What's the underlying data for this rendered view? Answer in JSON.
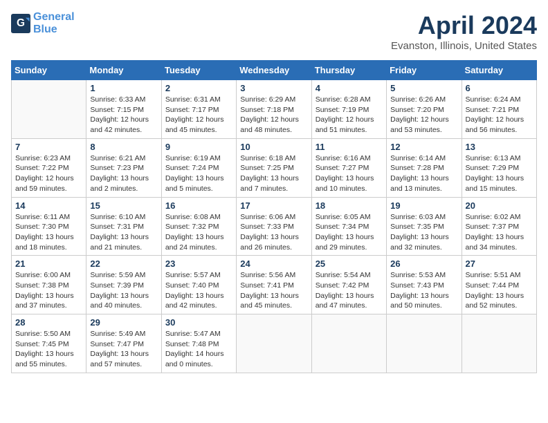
{
  "header": {
    "logo_line1": "General",
    "logo_line2": "Blue",
    "month_title": "April 2024",
    "location": "Evanston, Illinois, United States"
  },
  "weekdays": [
    "Sunday",
    "Monday",
    "Tuesday",
    "Wednesday",
    "Thursday",
    "Friday",
    "Saturday"
  ],
  "weeks": [
    [
      {
        "day": "",
        "sunrise": "",
        "sunset": "",
        "daylight": "",
        "empty": true
      },
      {
        "day": "1",
        "sunrise": "Sunrise: 6:33 AM",
        "sunset": "Sunset: 7:15 PM",
        "daylight": "Daylight: 12 hours and 42 minutes."
      },
      {
        "day": "2",
        "sunrise": "Sunrise: 6:31 AM",
        "sunset": "Sunset: 7:17 PM",
        "daylight": "Daylight: 12 hours and 45 minutes."
      },
      {
        "day": "3",
        "sunrise": "Sunrise: 6:29 AM",
        "sunset": "Sunset: 7:18 PM",
        "daylight": "Daylight: 12 hours and 48 minutes."
      },
      {
        "day": "4",
        "sunrise": "Sunrise: 6:28 AM",
        "sunset": "Sunset: 7:19 PM",
        "daylight": "Daylight: 12 hours and 51 minutes."
      },
      {
        "day": "5",
        "sunrise": "Sunrise: 6:26 AM",
        "sunset": "Sunset: 7:20 PM",
        "daylight": "Daylight: 12 hours and 53 minutes."
      },
      {
        "day": "6",
        "sunrise": "Sunrise: 6:24 AM",
        "sunset": "Sunset: 7:21 PM",
        "daylight": "Daylight: 12 hours and 56 minutes."
      }
    ],
    [
      {
        "day": "7",
        "sunrise": "Sunrise: 6:23 AM",
        "sunset": "Sunset: 7:22 PM",
        "daylight": "Daylight: 12 hours and 59 minutes."
      },
      {
        "day": "8",
        "sunrise": "Sunrise: 6:21 AM",
        "sunset": "Sunset: 7:23 PM",
        "daylight": "Daylight: 13 hours and 2 minutes."
      },
      {
        "day": "9",
        "sunrise": "Sunrise: 6:19 AM",
        "sunset": "Sunset: 7:24 PM",
        "daylight": "Daylight: 13 hours and 5 minutes."
      },
      {
        "day": "10",
        "sunrise": "Sunrise: 6:18 AM",
        "sunset": "Sunset: 7:25 PM",
        "daylight": "Daylight: 13 hours and 7 minutes."
      },
      {
        "day": "11",
        "sunrise": "Sunrise: 6:16 AM",
        "sunset": "Sunset: 7:27 PM",
        "daylight": "Daylight: 13 hours and 10 minutes."
      },
      {
        "day": "12",
        "sunrise": "Sunrise: 6:14 AM",
        "sunset": "Sunset: 7:28 PM",
        "daylight": "Daylight: 13 hours and 13 minutes."
      },
      {
        "day": "13",
        "sunrise": "Sunrise: 6:13 AM",
        "sunset": "Sunset: 7:29 PM",
        "daylight": "Daylight: 13 hours and 15 minutes."
      }
    ],
    [
      {
        "day": "14",
        "sunrise": "Sunrise: 6:11 AM",
        "sunset": "Sunset: 7:30 PM",
        "daylight": "Daylight: 13 hours and 18 minutes."
      },
      {
        "day": "15",
        "sunrise": "Sunrise: 6:10 AM",
        "sunset": "Sunset: 7:31 PM",
        "daylight": "Daylight: 13 hours and 21 minutes."
      },
      {
        "day": "16",
        "sunrise": "Sunrise: 6:08 AM",
        "sunset": "Sunset: 7:32 PM",
        "daylight": "Daylight: 13 hours and 24 minutes."
      },
      {
        "day": "17",
        "sunrise": "Sunrise: 6:06 AM",
        "sunset": "Sunset: 7:33 PM",
        "daylight": "Daylight: 13 hours and 26 minutes."
      },
      {
        "day": "18",
        "sunrise": "Sunrise: 6:05 AM",
        "sunset": "Sunset: 7:34 PM",
        "daylight": "Daylight: 13 hours and 29 minutes."
      },
      {
        "day": "19",
        "sunrise": "Sunrise: 6:03 AM",
        "sunset": "Sunset: 7:35 PM",
        "daylight": "Daylight: 13 hours and 32 minutes."
      },
      {
        "day": "20",
        "sunrise": "Sunrise: 6:02 AM",
        "sunset": "Sunset: 7:37 PM",
        "daylight": "Daylight: 13 hours and 34 minutes."
      }
    ],
    [
      {
        "day": "21",
        "sunrise": "Sunrise: 6:00 AM",
        "sunset": "Sunset: 7:38 PM",
        "daylight": "Daylight: 13 hours and 37 minutes."
      },
      {
        "day": "22",
        "sunrise": "Sunrise: 5:59 AM",
        "sunset": "Sunset: 7:39 PM",
        "daylight": "Daylight: 13 hours and 40 minutes."
      },
      {
        "day": "23",
        "sunrise": "Sunrise: 5:57 AM",
        "sunset": "Sunset: 7:40 PM",
        "daylight": "Daylight: 13 hours and 42 minutes."
      },
      {
        "day": "24",
        "sunrise": "Sunrise: 5:56 AM",
        "sunset": "Sunset: 7:41 PM",
        "daylight": "Daylight: 13 hours and 45 minutes."
      },
      {
        "day": "25",
        "sunrise": "Sunrise: 5:54 AM",
        "sunset": "Sunset: 7:42 PM",
        "daylight": "Daylight: 13 hours and 47 minutes."
      },
      {
        "day": "26",
        "sunrise": "Sunrise: 5:53 AM",
        "sunset": "Sunset: 7:43 PM",
        "daylight": "Daylight: 13 hours and 50 minutes."
      },
      {
        "day": "27",
        "sunrise": "Sunrise: 5:51 AM",
        "sunset": "Sunset: 7:44 PM",
        "daylight": "Daylight: 13 hours and 52 minutes."
      }
    ],
    [
      {
        "day": "28",
        "sunrise": "Sunrise: 5:50 AM",
        "sunset": "Sunset: 7:45 PM",
        "daylight": "Daylight: 13 hours and 55 minutes."
      },
      {
        "day": "29",
        "sunrise": "Sunrise: 5:49 AM",
        "sunset": "Sunset: 7:47 PM",
        "daylight": "Daylight: 13 hours and 57 minutes."
      },
      {
        "day": "30",
        "sunrise": "Sunrise: 5:47 AM",
        "sunset": "Sunset: 7:48 PM",
        "daylight": "Daylight: 14 hours and 0 minutes."
      },
      {
        "day": "",
        "sunrise": "",
        "sunset": "",
        "daylight": "",
        "empty": true
      },
      {
        "day": "",
        "sunrise": "",
        "sunset": "",
        "daylight": "",
        "empty": true
      },
      {
        "day": "",
        "sunrise": "",
        "sunset": "",
        "daylight": "",
        "empty": true
      },
      {
        "day": "",
        "sunrise": "",
        "sunset": "",
        "daylight": "",
        "empty": true
      }
    ]
  ]
}
